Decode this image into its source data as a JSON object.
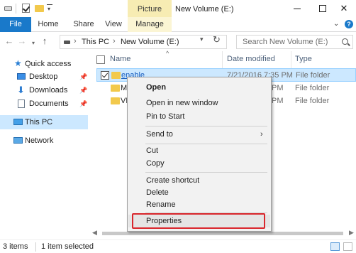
{
  "titlebar": {
    "contextual_tab_group": "Picture Tools",
    "window_title": "New Volume (E:)"
  },
  "ribbon": {
    "tabs": [
      "File",
      "Home",
      "Share",
      "View",
      "Manage"
    ],
    "help_label": "?"
  },
  "address_bar": {
    "crumbs": [
      "This PC",
      "New Volume (E:)"
    ],
    "search_placeholder": "Search New Volume (E:)"
  },
  "nav_pane": {
    "quick_access": "Quick access",
    "items": [
      {
        "label": "Desktop",
        "icon": "desktop-icon",
        "pinned": true
      },
      {
        "label": "Downloads",
        "icon": "downloads-icon",
        "pinned": true
      },
      {
        "label": "Documents",
        "icon": "documents-icon",
        "pinned": true
      }
    ],
    "this_pc": "This PC",
    "network": "Network"
  },
  "file_list": {
    "columns": [
      "Name",
      "Date modified",
      "Type"
    ],
    "rows": [
      {
        "name": "enable",
        "date": "7/21/2016 7:35 PM",
        "type": "File folder",
        "selected": true
      },
      {
        "name": "M",
        "date": "PM",
        "type": "File folder",
        "selected": false
      },
      {
        "name": "VR",
        "date": "PM",
        "type": "File folder",
        "selected": false
      }
    ]
  },
  "context_menu": {
    "items": [
      "Open",
      "Open in new window",
      "Pin to Start",
      "Send to",
      "Cut",
      "Copy",
      "Create shortcut",
      "Delete",
      "Rename",
      "Properties"
    ]
  },
  "statusbar": {
    "item_count": "3 items",
    "selection": "1 item selected"
  },
  "colors": {
    "accent": "#1979ca",
    "selection": "#cce8ff",
    "highlight_box": "#d9262c"
  }
}
